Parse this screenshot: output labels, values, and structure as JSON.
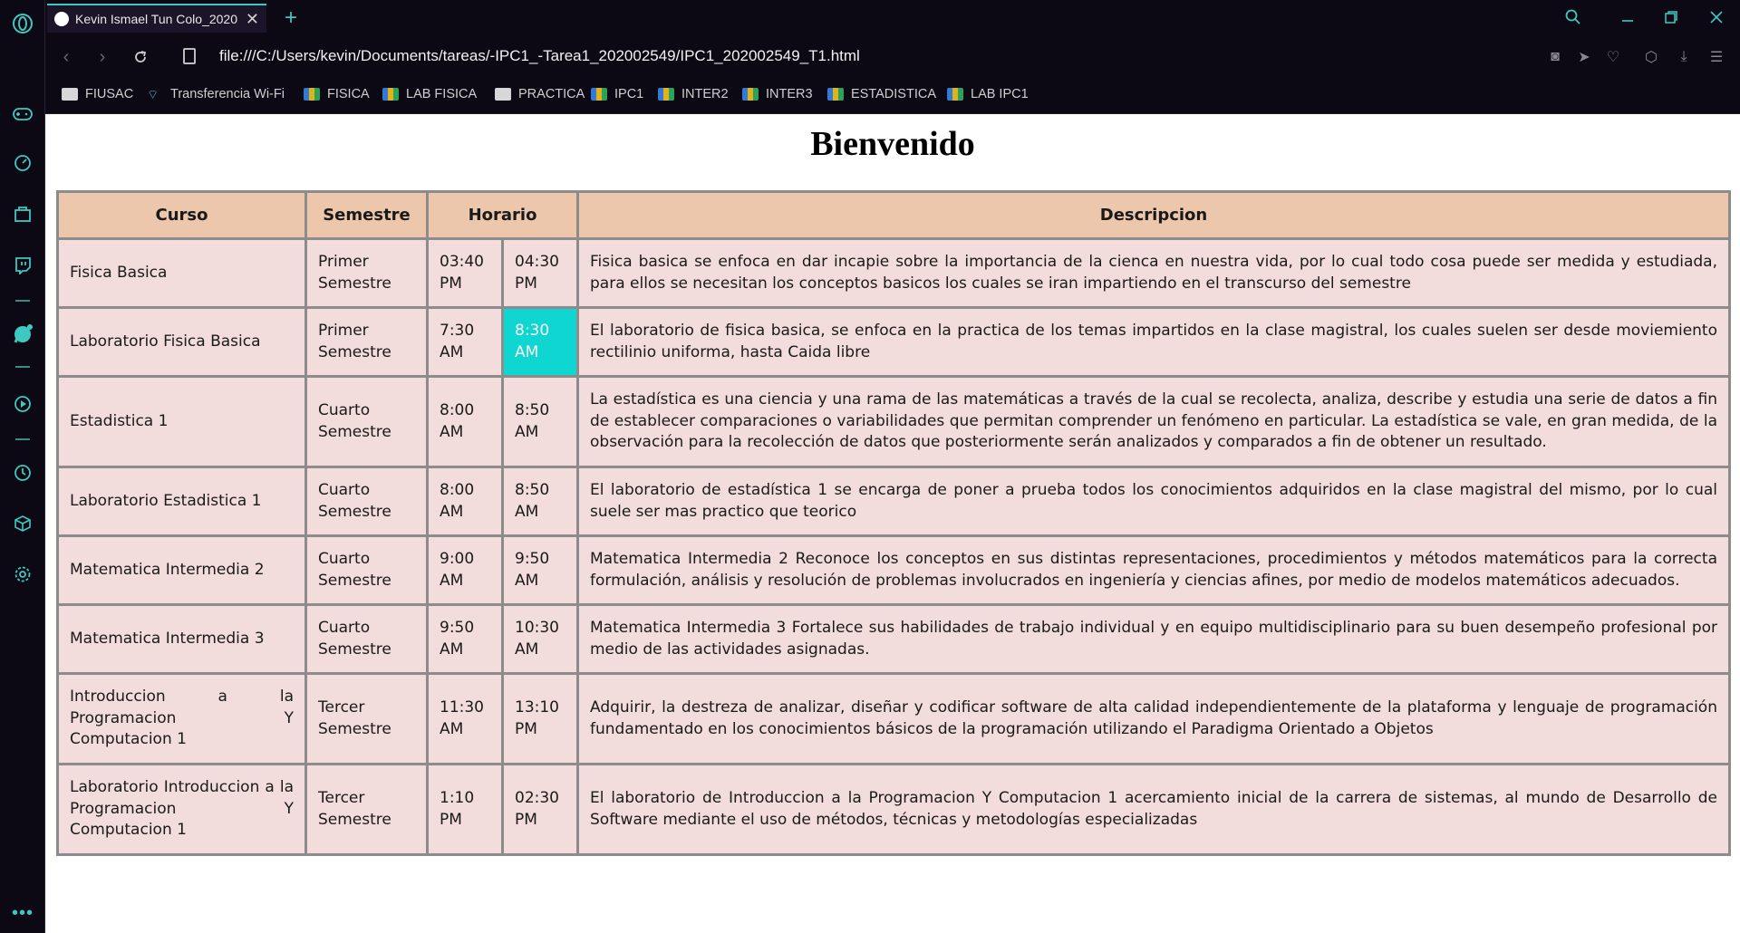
{
  "browser": {
    "tab_title": "Kevin Ismael Tun Colo_2020",
    "url": "file:///C:/Users/kevin/Documents/tareas/-IPC1_-Tarea1_202002549/IPC1_202002549_T1.html",
    "accent_color": "#3ec9c0"
  },
  "bookmarks": [
    {
      "label": "FIUSAC",
      "icon": "fiusac-icon"
    },
    {
      "label": "Transferencia Wi-Fi",
      "icon": "wifi-icon"
    },
    {
      "label": "FISICA",
      "icon": "classroom-icon"
    },
    {
      "label": "LAB FISICA",
      "icon": "classroom-icon"
    },
    {
      "label": "PRACTICA",
      "icon": "page-icon"
    },
    {
      "label": "IPC1",
      "icon": "classroom-icon"
    },
    {
      "label": "INTER2",
      "icon": "classroom-icon"
    },
    {
      "label": "INTER3",
      "icon": "classroom-icon"
    },
    {
      "label": "ESTADISTICA",
      "icon": "classroom-icon"
    },
    {
      "label": "LAB IPC1",
      "icon": "classroom-icon"
    }
  ],
  "page": {
    "title": "Bienvenido",
    "table": {
      "headers": [
        "Curso",
        "Semestre",
        "Horario",
        "Descripcion"
      ],
      "header_color": "#edc7ab",
      "row_color": "#f3dcdc",
      "highlight_color": "#10d6d1",
      "rows": [
        {
          "curso": "Fisica Basica",
          "semestre": "Primer Semestre",
          "inicio": "03:40 PM",
          "fin": "04:30 PM",
          "descripcion": "Fisica basica se enfoca en dar incapie sobre la importancia de la cienca en nuestra vida, por lo cual todo cosa puede ser medida y estudiada, para ellos se necesitan los conceptos basicos los cuales se iran impartiendo en el transcurso del semestre"
        },
        {
          "curso": "Laboratorio Fisica Basica",
          "semestre": "Primer Semestre",
          "inicio": "7:30 AM",
          "fin": "8:30 AM",
          "descripcion": "El laboratorio de fisica basica, se enfoca en la practica de los temas impartidos en la clase magistral, los cuales suelen ser desde moviemiento rectilinio uniforma, hasta Caida libre"
        },
        {
          "curso": "Estadistica 1",
          "semestre": "Cuarto Semestre",
          "inicio": "8:00 AM",
          "fin": "8:50 AM",
          "descripcion": "La estadística es una ciencia y una rama de las matemáticas a través de la cual se recolecta, analiza, describe y estudia una serie de datos a fin de establecer comparaciones o variabilidades que permitan comprender un fenómeno en particular. La estadística se vale, en gran medida, de la observación para la recolección de datos que posteriormente serán analizados y comparados a fin de obtener un resultado."
        },
        {
          "curso": "Laboratorio Estadistica 1",
          "semestre": "Cuarto Semestre",
          "inicio": "8:00 AM",
          "fin": "8:50 AM",
          "descripcion": "El laboratorio de estadística 1 se encarga de poner a prueba todos los conocimientos adquiridos en la clase magistral del mismo, por lo cual suele ser mas practico que teorico"
        },
        {
          "curso": "Matematica Intermedia 2",
          "semestre": "Cuarto Semestre",
          "inicio": "9:00 AM",
          "fin": "9:50 AM",
          "descripcion": "Matematica Intermedia 2 Reconoce los conceptos en sus distintas representaciones, procedimientos y métodos matemáticos para la correcta formulación, análisis y resolución de problemas involucrados en ingeniería y ciencias afines, por medio de modelos matemáticos adecuados."
        },
        {
          "curso": "Matematica Intermedia 3",
          "semestre": "Cuarto Semestre",
          "inicio": "9:50 AM",
          "fin": "10:30 AM",
          "descripcion": "Matematica Intermedia 3 Fortalece sus habilidades de trabajo individual y en equipo multidisciplinario para su buen desempeño profesional por medio de las actividades asignadas."
        },
        {
          "curso": "Introduccion a la Programacion Y Computacion 1",
          "semestre": "Tercer Semestre",
          "inicio": "11:30 AM",
          "fin": "13:10 PM",
          "descripcion": "Adquirir, la destreza de analizar, diseñar y codificar software de alta calidad independientemente de la plataforma y lenguaje de programación fundamentado en los conocimientos básicos de la programación utilizando el Paradigma Orientado a Objetos"
        },
        {
          "curso": "Laboratorio Introduccion a la Programacion Y Computacion 1",
          "semestre": "Tercer Semestre",
          "inicio": "1:10 PM",
          "fin": "02:30 PM",
          "descripcion": "El laboratorio de Introduccion a la Programacion Y Computacion 1 acercamiento inicial de la carrera de sistemas, al mundo de Desarrollo de Software mediante el uso de métodos, técnicas y metodologías especializadas"
        }
      ]
    }
  }
}
